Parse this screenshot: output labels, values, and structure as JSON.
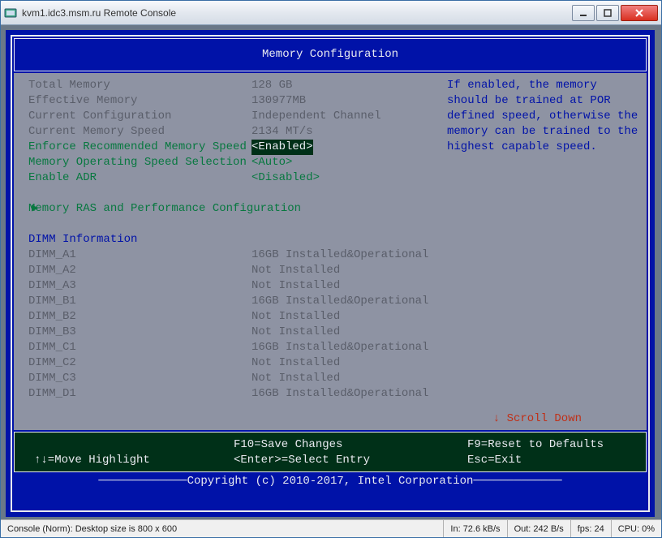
{
  "window": {
    "title": "kvm1.idc3.msm.ru Remote Console"
  },
  "bios": {
    "header": "Memory Configuration",
    "help_text": "If enabled, the memory should be trained at POR defined speed, otherwise the memory can be trained to the highest capable speed.",
    "scroll_hint": "↓ Scroll Down",
    "settings": {
      "total_memory_l": "Total Memory",
      "total_memory_v": "128 GB",
      "effective_memory_l": "Effective Memory",
      "effective_memory_v": "130977MB",
      "current_config_l": "Current Configuration",
      "current_config_v": "Independent Channel",
      "current_speed_l": "Current Memory Speed",
      "current_speed_v": "2134 MT/s",
      "enforce_l": "Enforce Recommended Memory Speed",
      "enforce_v": "<Enabled>",
      "op_select_l": "Memory Operating Speed Selection",
      "op_select_v": "<Auto>",
      "enable_adr_l": "Enable ADR",
      "enable_adr_v": "<Disabled>"
    },
    "ras_menu": "Memory RAS and Performance Configuration",
    "dimm_heading": "DIMM Information",
    "dimms": [
      {
        "slot": "DIMM_A1",
        "status": "16GB Installed&Operational"
      },
      {
        "slot": "DIMM_A2",
        "status": "Not Installed"
      },
      {
        "slot": "DIMM_A3",
        "status": "Not Installed"
      },
      {
        "slot": "DIMM_B1",
        "status": "16GB Installed&Operational"
      },
      {
        "slot": "DIMM_B2",
        "status": "Not Installed"
      },
      {
        "slot": "DIMM_B3",
        "status": "Not Installed"
      },
      {
        "slot": "DIMM_C1",
        "status": "16GB Installed&Operational"
      },
      {
        "slot": "DIMM_C2",
        "status": "Not Installed"
      },
      {
        "slot": "DIMM_C3",
        "status": "Not Installed"
      },
      {
        "slot": "DIMM_D1",
        "status": "16GB Installed&Operational"
      }
    ],
    "footer": {
      "nav": "↑↓=Move Highlight",
      "save": "F10=Save Changes",
      "select": "<Enter>=Select Entry",
      "reset": "F9=Reset to Defaults",
      "exit": "Esc=Exit"
    },
    "copyright": "Copyright (c) 2010-2017, Intel Corporation"
  },
  "status": {
    "console": "Console (Norm): Desktop size is 800 x 600",
    "in": "In: 72.6 kB/s",
    "out": "Out: 242 B/s",
    "fps": "fps: 24",
    "cpu": "CPU: 0%"
  }
}
